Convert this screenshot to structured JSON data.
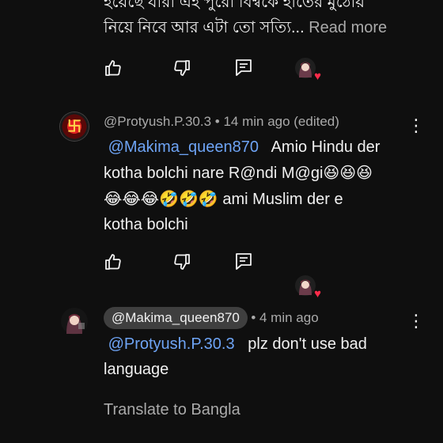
{
  "comment0": {
    "line1_partial": "হয়েছে যারা এই পুরো বিশ্বকে হাতের মুঠোয়",
    "line2": "নিয়ে নিবে আর এটা তো সত্যি...",
    "read_more": "Read more"
  },
  "comment1": {
    "author": "@Protyush.P.30.3",
    "time": "• 14 min ago (edited)",
    "mention": "@Makima_queen870",
    "line1_rest": "Amio Hindu der",
    "line2": "kotha bolchi nare R@ndi M@gi",
    "line2_emoji": "😆😆😆",
    "line3_emoji": "😂😂😂🤣🤣🤣",
    "line3_text": "ami Muslim der e",
    "line4": "kotha bolchi"
  },
  "comment2": {
    "author_chip": "@Makima_queen870",
    "time": "• 4 min ago",
    "mention": "@Protyush.P.30.3",
    "line1_rest": "plz don't use bad",
    "line2": "language",
    "translate": "Translate to Bangla"
  },
  "icons": {
    "like": "thumbs-up-icon",
    "dislike": "thumbs-down-icon",
    "reply": "reply-icon",
    "more": "more-vertical-icon",
    "heart": "heart-icon"
  },
  "glyphs": {
    "kebab": "⋮",
    "heart": "♥",
    "swastika": "卐"
  },
  "colors": {
    "background": "#0f0f0f",
    "mention": "#6ea4f5",
    "heart": "#ff2b4a",
    "chip": "#3f3f3f"
  }
}
